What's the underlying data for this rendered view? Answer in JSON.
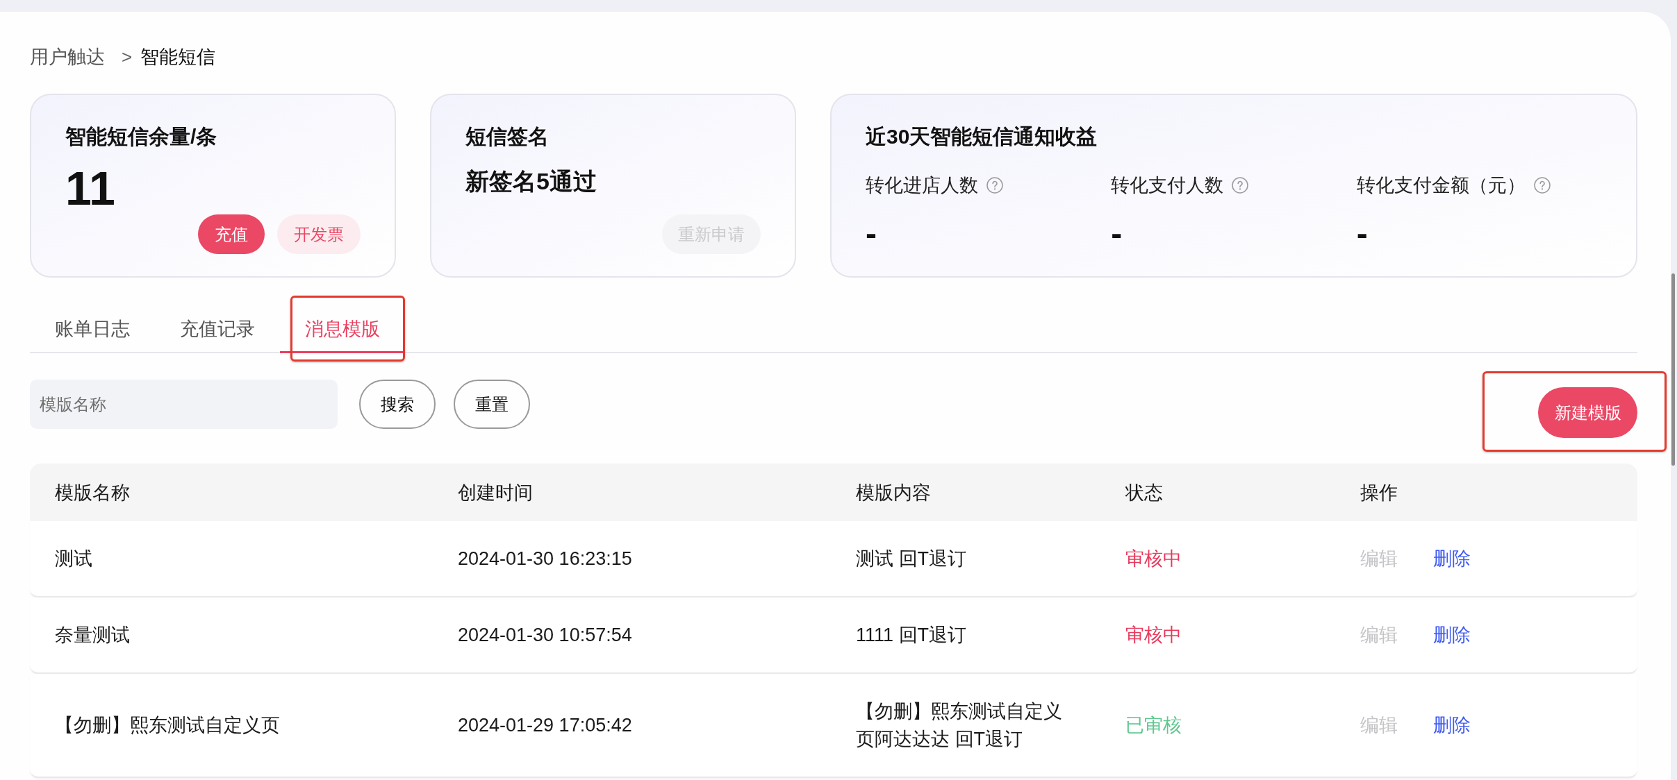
{
  "breadcrumb": {
    "separator": ">",
    "items": [
      {
        "label": "用户触达",
        "current": false
      },
      {
        "label": "智能短信",
        "current": true
      }
    ]
  },
  "balance_card": {
    "title": "智能短信余量/条",
    "value": "11",
    "buttons": [
      {
        "label": "充值",
        "kind": "primary"
      },
      {
        "label": "开发票",
        "kind": "secondary"
      }
    ]
  },
  "signature_card": {
    "title": "短信签名",
    "value": "新签名5通过",
    "button": {
      "label": "重新申请",
      "disabled": true
    }
  },
  "revenue_card": {
    "title": "近30天智能短信通知收益",
    "metrics": [
      {
        "label": "转化进店人数",
        "value": "-"
      },
      {
        "label": "转化支付人数",
        "value": "-"
      },
      {
        "label": "转化支付金额（元）",
        "value": "-"
      }
    ]
  },
  "tabs": [
    {
      "label": "账单日志",
      "selected": false,
      "highlighted": false
    },
    {
      "label": "充值记录",
      "selected": false,
      "highlighted": false
    },
    {
      "label": "消息模版",
      "selected": true,
      "highlighted": true
    }
  ],
  "search": {
    "placeholder": "模版名称",
    "buttons": [
      "搜索",
      "重置"
    ]
  },
  "create_button": {
    "label": "新建模版",
    "highlighted": true
  },
  "table": {
    "columns": [
      "模版名称",
      "创建时间",
      "模版内容",
      "状态",
      "操作"
    ],
    "rows": [
      {
        "name": "测试",
        "created": "2024-01-30 16:23:15",
        "content": "测试 回T退订",
        "status": {
          "label": "审核中",
          "color": "#e8395b"
        },
        "actions": [
          {
            "label": "编辑",
            "disabled": true
          },
          {
            "label": "删除",
            "disabled": false
          }
        ]
      },
      {
        "name": "奈量测试",
        "created": "2024-01-30 10:57:54",
        "content": "1111 回T退订",
        "status": {
          "label": "审核中",
          "color": "#e8395b"
        },
        "actions": [
          {
            "label": "编辑",
            "disabled": true
          },
          {
            "label": "删除",
            "disabled": false
          }
        ]
      },
      {
        "name": "【勿删】熙东测试自定义页",
        "created": "2024-01-29 17:05:42",
        "content": "【勿删】熙东测试自定义页阿达达达 回T退订",
        "status": {
          "label": "已审核",
          "color": "#5ec78e"
        },
        "actions": [
          {
            "label": "编辑",
            "disabled": true
          },
          {
            "label": "删除",
            "disabled": false
          }
        ]
      }
    ]
  }
}
